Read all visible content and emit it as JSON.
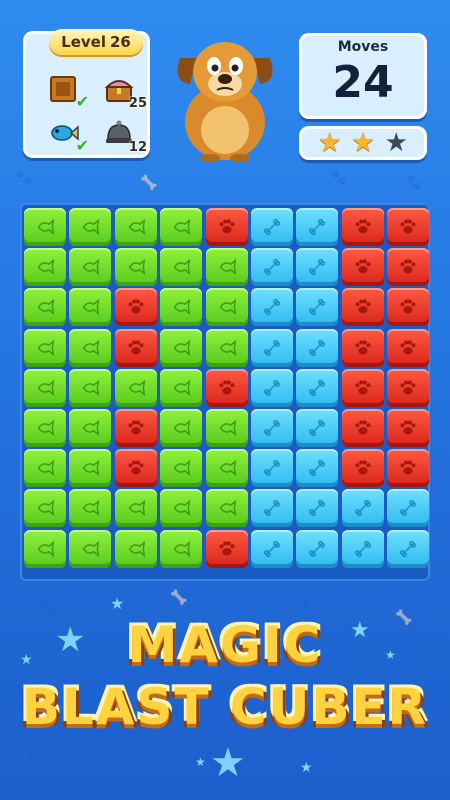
{
  "level": {
    "label": "Level",
    "number": "26"
  },
  "goals": [
    {
      "icon": "crate-icon",
      "count": "",
      "done": true
    },
    {
      "icon": "treasure-chest-icon",
      "count": "25",
      "done": false
    },
    {
      "icon": "fish-icon",
      "count": "",
      "done": true
    },
    {
      "icon": "bell-dome-icon",
      "count": "12",
      "done": false
    }
  ],
  "moves": {
    "label": "Moves",
    "value": "24"
  },
  "stars": {
    "earned": 2,
    "total": 3
  },
  "board": {
    "columns": 9,
    "rows": 9,
    "grid": [
      [
        "green",
        "green",
        "green",
        "green",
        "red",
        "blue",
        "blue",
        "red",
        "red"
      ],
      [
        "green",
        "green",
        "green",
        "green",
        "green",
        "blue",
        "blue",
        "red",
        "red"
      ],
      [
        "green",
        "green",
        "red",
        "green",
        "green",
        "blue",
        "blue",
        "red",
        "red"
      ],
      [
        "green",
        "green",
        "red",
        "green",
        "green",
        "blue",
        "blue",
        "red",
        "red"
      ],
      [
        "green",
        "green",
        "green",
        "green",
        "red",
        "blue",
        "blue",
        "red",
        "red"
      ],
      [
        "green",
        "green",
        "red",
        "green",
        "green",
        "blue",
        "blue",
        "red",
        "red"
      ],
      [
        "green",
        "green",
        "red",
        "green",
        "green",
        "blue",
        "blue",
        "red",
        "red"
      ],
      [
        "green",
        "green",
        "green",
        "green",
        "green",
        "blue",
        "blue",
        "blue",
        "blue"
      ],
      [
        "green",
        "green",
        "green",
        "green",
        "red",
        "blue",
        "blue",
        "blue",
        "blue"
      ]
    ],
    "tile_icons": {
      "green": "fish-icon",
      "red": "paw-icon",
      "blue": "bone-icon"
    },
    "colors": {
      "green": "#6ad82a",
      "red": "#e8321f",
      "blue": "#3cc8f4"
    }
  },
  "title": {
    "line1": "MAGIC",
    "line2": "BLAST CUBER"
  },
  "theme": {
    "background": "#2478e0",
    "title_color": "#ffd23f"
  }
}
